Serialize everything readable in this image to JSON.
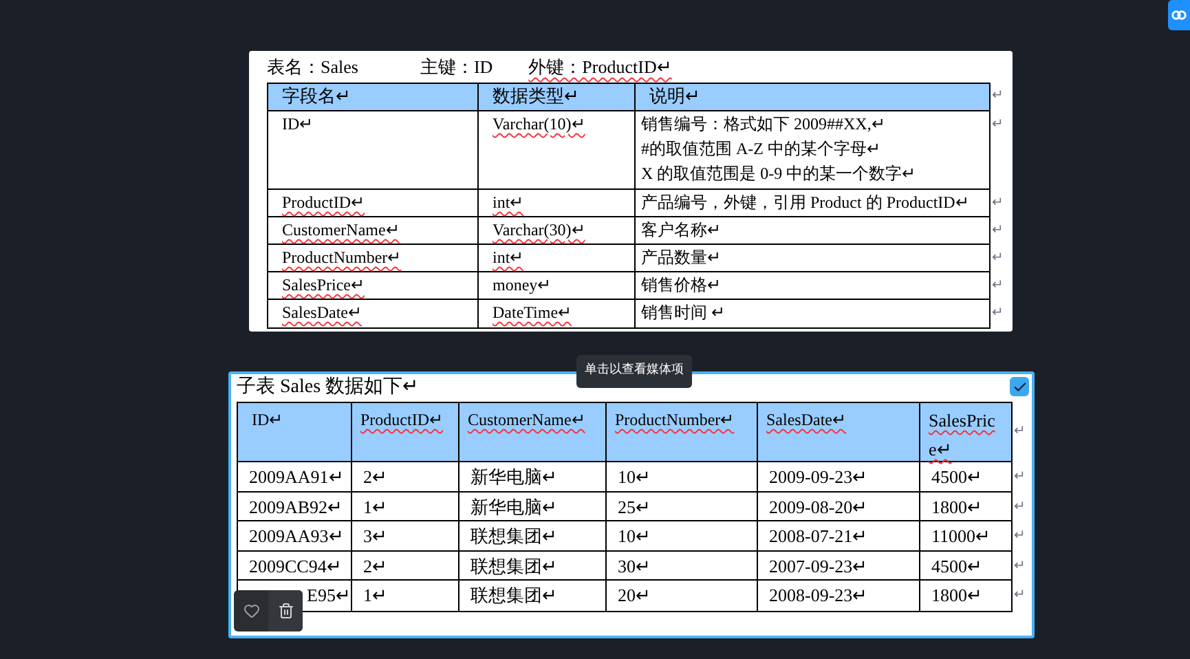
{
  "doc_image": {
    "meta": [
      {
        "text": "表名：Sales",
        "underlined": false
      },
      {
        "text": "主键：ID",
        "underlined": false
      },
      {
        "text": "外键：ProductID↵",
        "underlined": true
      }
    ],
    "columns": [
      {
        "text": "字段名↵",
        "underlined": false
      },
      {
        "text": "数据类型↵",
        "underlined": false
      },
      {
        "text": "说明↵",
        "underlined": false
      }
    ],
    "header_end": "↵",
    "rows": [
      {
        "field": {
          "text": "ID↵",
          "underlined": false
        },
        "type": {
          "text": "Varchar(10)↵",
          "underlined": true
        },
        "description": [
          "销售编号：格式如下 2009##XX,↵",
          "#的取值范围 A-Z 中的某个字母↵",
          "X 的取值范围是 0-9 中的某一个数字↵"
        ],
        "end": "↵"
      },
      {
        "field": {
          "text": "ProductID↵",
          "underlined": true
        },
        "type": {
          "text": "int↵",
          "underlined": true
        },
        "description": [
          "产品编号，外键，引用 Product 的 ProductID↵"
        ],
        "end": "↵"
      },
      {
        "field": {
          "text": "CustomerName↵",
          "underlined": true
        },
        "type": {
          "text": "Varchar(30)↵",
          "underlined": true
        },
        "description": [
          "客户名称↵"
        ],
        "end": "↵"
      },
      {
        "field": {
          "text": "ProductNumber↵",
          "underlined": true
        },
        "type": {
          "text": "int↵",
          "underlined": true
        },
        "description": [
          "产品数量↵"
        ],
        "end": "↵"
      },
      {
        "field": {
          "text": "SalesPrice↵",
          "underlined": true
        },
        "type": {
          "text": "money↵",
          "underlined": false
        },
        "description": [
          "销售价格↵"
        ],
        "end": "↵"
      },
      {
        "field": {
          "text": "SalesDate↵",
          "underlined": true
        },
        "type": {
          "text": "DateTime↵",
          "underlined": true
        },
        "description": [
          "销售时间 ↵"
        ],
        "end": "↵"
      }
    ]
  },
  "selected_image": {
    "selected": true,
    "tooltip": "单击以查看媒体项",
    "caption": "子表 Sales 数据如下↵",
    "columns": [
      {
        "text": "ID↵",
        "underlined": false
      },
      {
        "text": "ProductID↵",
        "underlined": true
      },
      {
        "text": "CustomerName↵",
        "underlined": true
      },
      {
        "text": "ProductNumber↵",
        "underlined": true
      },
      {
        "text": "SalesDate↵",
        "underlined": true
      },
      {
        "text": "SalesPrice↵",
        "underlined": true
      }
    ],
    "header_end": "↵",
    "rows": [
      {
        "cells": [
          "2009AA91↵",
          "2↵",
          "新华电脑↵",
          "10↵",
          "2009-09-23↵",
          "4500↵"
        ],
        "end": "↵"
      },
      {
        "cells": [
          "2009AB92↵",
          "1↵",
          "新华电脑↵",
          "25↵",
          "2009-08-20↵",
          "1800↵"
        ],
        "end": "↵"
      },
      {
        "cells": [
          "2009AA93↵",
          "3↵",
          "联想集团↵",
          "10↵",
          "2008-07-21↵",
          "11000↵"
        ],
        "end": "↵"
      },
      {
        "cells": [
          "2009CC94↵",
          "2↵",
          "联想集团↵",
          "30↵",
          "2007-09-23↵",
          "4500↵"
        ],
        "end": "↵"
      },
      {
        "cells": [
          "E95↵",
          "1↵",
          "联想集团↵",
          "20↵",
          "2008-09-23↵",
          "1800↵"
        ],
        "end": "↵"
      }
    ]
  }
}
